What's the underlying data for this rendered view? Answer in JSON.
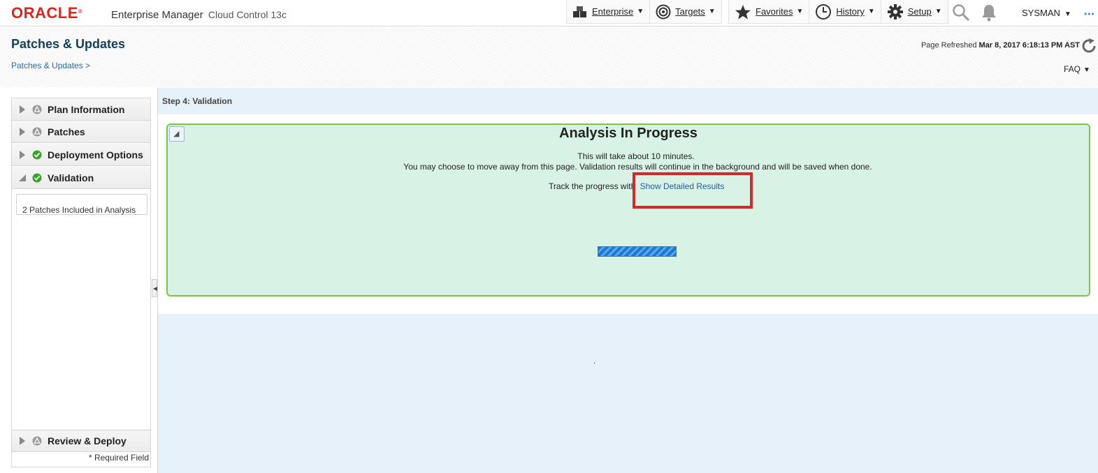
{
  "app": {
    "brand": "ORACLE",
    "brand_mark": "®",
    "product_name": "Enterprise Manager",
    "product_edition": "Cloud Control 13c"
  },
  "nav": {
    "enterprise": "Enterprise",
    "targets": "Targets",
    "favorites": "Favorites",
    "history": "History",
    "setup": "Setup",
    "user": "SYSMAN"
  },
  "page": {
    "title": "Patches & Updates",
    "breadcrumb": "Patches & Updates >",
    "refreshed_label": "Page Refreshed",
    "refreshed_time": "Mar 8, 2017 6:18:13 PM AST",
    "faq": "FAQ"
  },
  "train": {
    "steps": [
      {
        "label": "Plan Information",
        "status": "pending"
      },
      {
        "label": "Patches",
        "status": "pending"
      },
      {
        "label": "Deployment Options",
        "status": "complete"
      },
      {
        "label": "Validation",
        "status": "complete"
      },
      {
        "label": "Review & Deploy",
        "status": "pending"
      }
    ],
    "patches_count": "2",
    "patches_text": "Patches Included in Analysis",
    "required_note": "* Required Field"
  },
  "main": {
    "step_header": "Step 4: Validation",
    "analysis_title": "Analysis In Progress",
    "msg1": "This will take about 10 minutes.",
    "msg2": "You may choose to move away from this page. Validation results will continue in the background and will be saved when done.",
    "track_text": "Track the progress with",
    "detail_link": "Show Detailed Results",
    "dot": "."
  },
  "colors": {
    "oracle_red": "#e2231a",
    "title_blue": "#13405c",
    "link_blue": "#1f5e9a",
    "status_green": "#39a52b",
    "box_border_green": "#7dc644",
    "box_fill_green": "#d9f2e6",
    "highlight_red": "#d9262b",
    "progress_blue": "#1f78d1"
  },
  "icons": {
    "enterprise": "enterprise-blocks-icon",
    "targets": "target-icon",
    "favorites": "star-icon",
    "history": "clock-icon",
    "setup": "gear-icon",
    "search": "search-icon",
    "notifications": "bell-icon",
    "refresh": "refresh-icon",
    "complete": "check-circle-icon",
    "pending": "warning-circle-icon"
  }
}
